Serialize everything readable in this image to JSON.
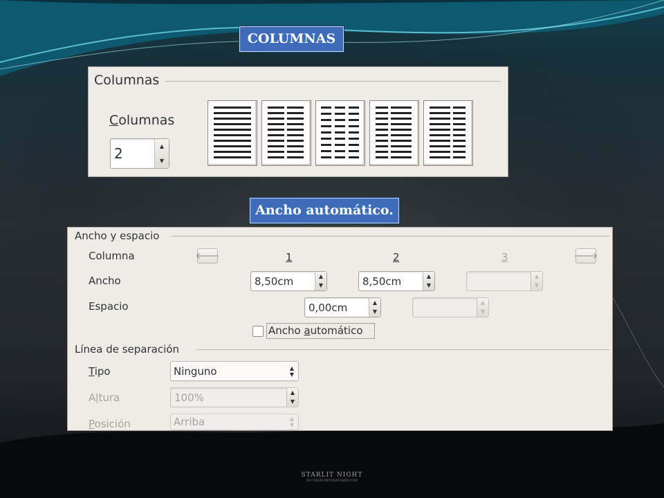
{
  "slide": {
    "title1": "COLUMNAS",
    "title2": "Ancho automático.",
    "watermark_line1": "STARLIT NIGHT",
    "watermark_line2": "DUCKEN.DEVIANTART.COM"
  },
  "columns_panel": {
    "group_title": "Columnas",
    "label_first": "C",
    "label_rest": "olumnas",
    "value": "2",
    "presets": [
      "preset-1",
      "preset-2",
      "preset-3",
      "preset-4",
      "preset-5"
    ]
  },
  "width_panel": {
    "group_title": "Ancho y espacio",
    "column_label": "Columna",
    "width_label": "Ancho",
    "space_label": "Espacio",
    "col_numbers": [
      "1",
      "2",
      "3"
    ],
    "width_values": [
      "8,50cm",
      "8,50cm",
      ""
    ],
    "space_values": [
      "0,00cm",
      ""
    ],
    "prev_icon": "arrow-left-icon",
    "next_icon": "arrow-right-icon",
    "auto_width": {
      "checked": false,
      "label_pre": "Ancho ",
      "label_u": "a",
      "label_post": "utomático"
    }
  },
  "separator_panel": {
    "group_title": "Línea de separación",
    "type_u": "T",
    "type_rest": "ipo",
    "type_value": "Ninguno",
    "height_pre": "A",
    "height_u": "l",
    "height_post": "tura",
    "height_value": "100%",
    "position_u": "P",
    "position_rest": "osición",
    "position_value": "Arriba"
  },
  "colors": {
    "title_bg": "#3d6db9",
    "panel_bg": "#efebe7"
  }
}
